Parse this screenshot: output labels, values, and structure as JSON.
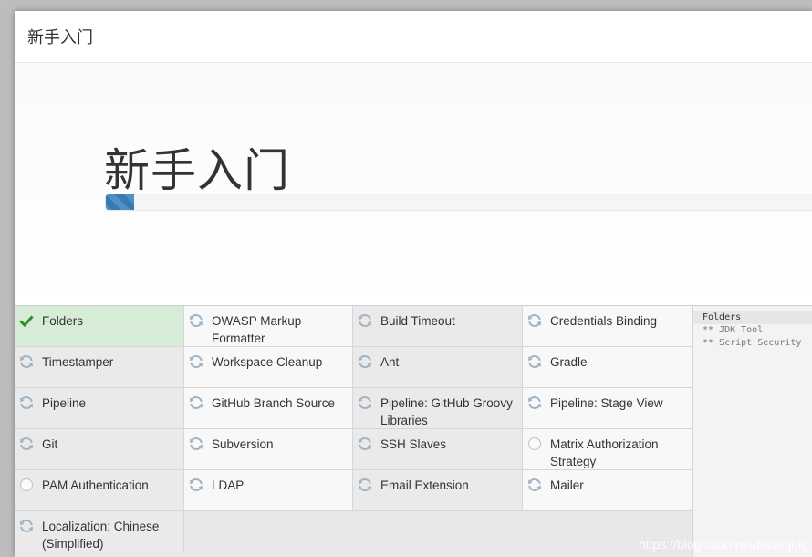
{
  "dialog": {
    "header_title": "新手入门",
    "hero_title": "新手入门",
    "progress_percent": 4
  },
  "plugins": [
    {
      "name": "Folders",
      "status": "success"
    },
    {
      "name": "OWASP Markup Formatter",
      "status": "pending"
    },
    {
      "name": "Build Timeout",
      "status": "pending"
    },
    {
      "name": "Credentials Binding",
      "status": "pending"
    },
    {
      "name": "Timestamper",
      "status": "pending"
    },
    {
      "name": "Workspace Cleanup",
      "status": "pending"
    },
    {
      "name": "Ant",
      "status": "pending"
    },
    {
      "name": "Gradle",
      "status": "pending"
    },
    {
      "name": "Pipeline",
      "status": "installing"
    },
    {
      "name": "GitHub Branch Source",
      "status": "pending"
    },
    {
      "name": "Pipeline: GitHub Groovy Libraries",
      "status": "installing"
    },
    {
      "name": "Pipeline: Stage View",
      "status": "pending"
    },
    {
      "name": "Git",
      "status": "pending"
    },
    {
      "name": "Subversion",
      "status": "pending"
    },
    {
      "name": "SSH Slaves",
      "status": "pending"
    },
    {
      "name": "Matrix Authorization Strategy",
      "status": "none"
    },
    {
      "name": "PAM Authentication",
      "status": "none"
    },
    {
      "name": "LDAP",
      "status": "pending"
    },
    {
      "name": "Email Extension",
      "status": "pending"
    },
    {
      "name": "Mailer",
      "status": "pending"
    },
    {
      "name": "Localization: Chinese (Simplified)",
      "status": "pending"
    }
  ],
  "log": [
    "Folders",
    "** JDK Tool",
    "** Script Security"
  ],
  "watermark": "https://blog.csdn.net/haveqing",
  "colors": {
    "success": "#2e8b2e",
    "pending": "#9fb3c4",
    "installing": "#9fb3c4",
    "progress": "#337ab7"
  }
}
